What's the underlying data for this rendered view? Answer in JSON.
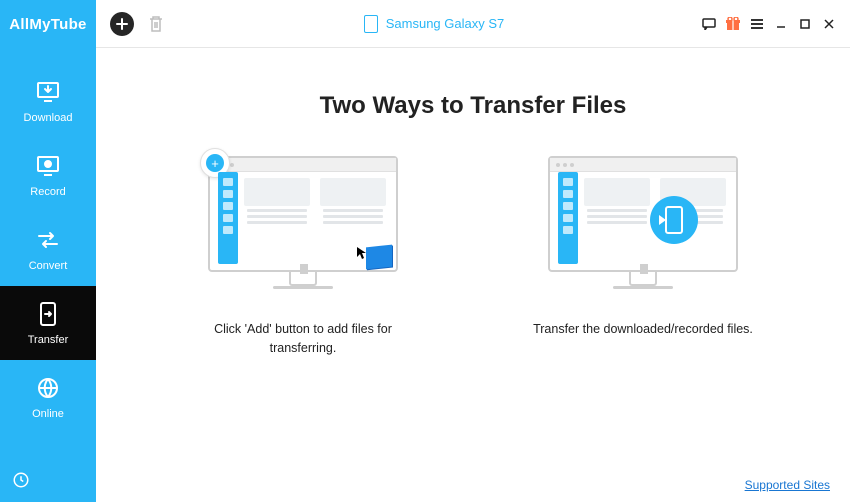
{
  "brand": "AllMyTube",
  "sidebar": {
    "items": [
      {
        "label": "Download",
        "icon": "download-icon"
      },
      {
        "label": "Record",
        "icon": "record-icon"
      },
      {
        "label": "Convert",
        "icon": "convert-icon"
      },
      {
        "label": "Transfer",
        "icon": "transfer-icon"
      },
      {
        "label": "Online",
        "icon": "online-icon"
      }
    ]
  },
  "topbar": {
    "device_name": "Samsung Galaxy S7"
  },
  "main": {
    "heading": "Two Ways to Transfer Files",
    "card1_caption": "Click 'Add' button to add files for transferring.",
    "card2_caption": "Transfer the downloaded/recorded files."
  },
  "footer": {
    "supported_sites": "Supported Sites"
  }
}
